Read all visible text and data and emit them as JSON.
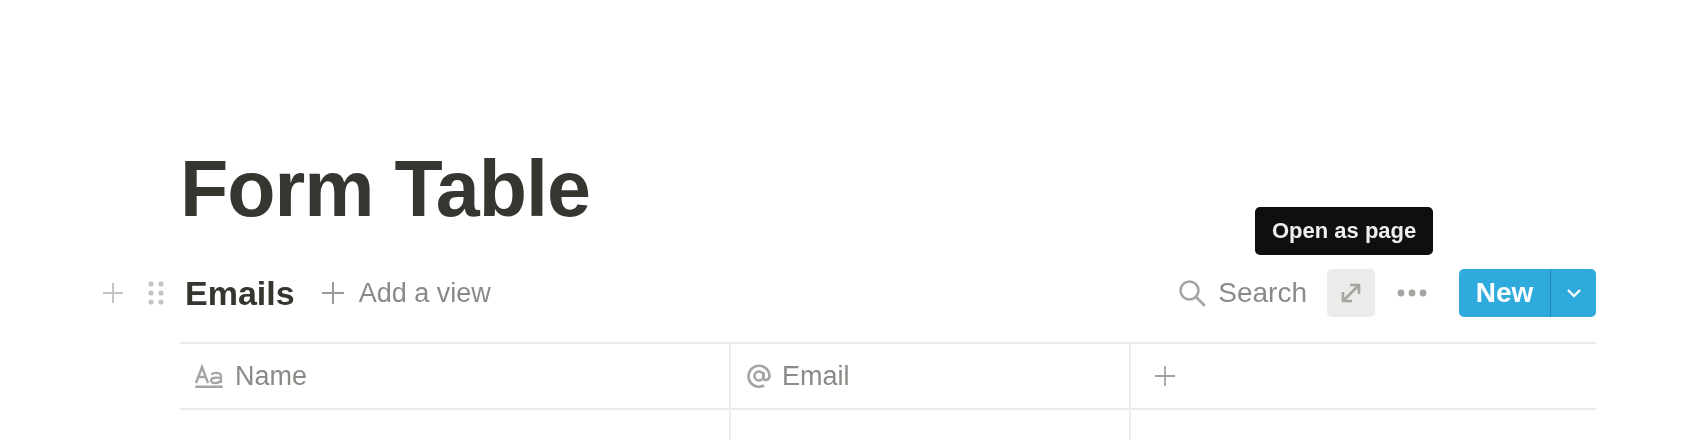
{
  "page": {
    "title": "Form Table"
  },
  "database": {
    "view_name": "Emails",
    "add_view": "Add a view",
    "search": "Search",
    "tooltip": "Open as page",
    "new_button": "New",
    "columns": [
      {
        "name": "Name",
        "kind": "text"
      },
      {
        "name": "Email",
        "kind": "email"
      }
    ]
  }
}
